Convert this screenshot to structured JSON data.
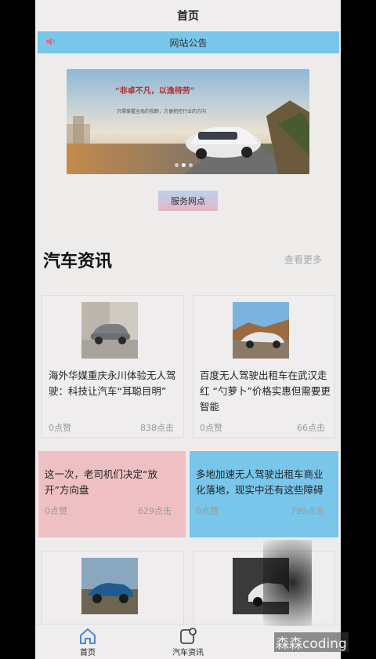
{
  "nav": {
    "title": "首页"
  },
  "notice": {
    "label": "网站公告",
    "icon": "speaker-icon"
  },
  "banner": {
    "slogan": "“非卓不凡，以逸待劳”",
    "subtitle": "只需掌握全局的视野，方便把控行业的方向"
  },
  "service_button": {
    "label": "服务网点"
  },
  "news_section": {
    "title": "汽车资讯",
    "more_label": "查看更多"
  },
  "news": [
    {
      "title": "海外华媒重庆永川体验无人驾驶：科技让汽车“耳聪目明”",
      "likes": "0点赞",
      "clicks": "838点击"
    },
    {
      "title": "百度无人驾驶出租车在武汉走红 “勺萝卜”价格实惠但需要更智能",
      "likes": "0点赞",
      "clicks": "66点击"
    },
    {
      "title": "这一次，老司机们决定“放开”方向盘",
      "likes": "0点赞",
      "clicks": "629点击",
      "bg": "#eec0c4"
    },
    {
      "title": "多地加速无人驾驶出租车商业化落地，现实中还有这些障碍",
      "likes": "0点赞",
      "clicks": "799点击",
      "bg": "#78c6ea"
    }
  ],
  "tabbar": [
    {
      "label": "首页",
      "icon": "home-icon"
    },
    {
      "label": "汽车资讯",
      "icon": "news-icon"
    }
  ],
  "watermark": "森森coding",
  "colors": {
    "accent_blue": "#78c6ea",
    "accent_pink": "#eec0c4",
    "background": "#eeeceb"
  }
}
